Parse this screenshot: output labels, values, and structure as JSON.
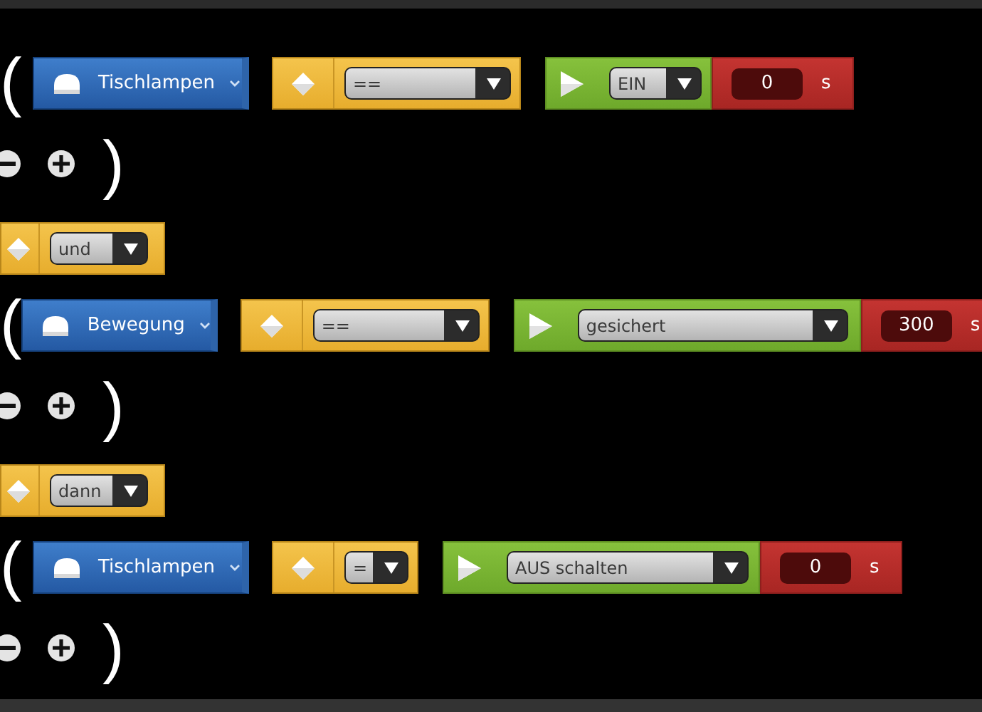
{
  "rows": [
    {
      "kind": "group",
      "open": "(",
      "device": "Tischlampen",
      "operator": "==",
      "value": "EIN",
      "delay": "0",
      "unit": "s",
      "close": ")"
    },
    {
      "kind": "connector",
      "value": "und"
    },
    {
      "kind": "group",
      "open": "(",
      "device": "Bewegung",
      "operator": "==",
      "value": "gesichert",
      "delay": "300",
      "unit": "s",
      "close": ")"
    },
    {
      "kind": "connector",
      "value": "dann"
    },
    {
      "kind": "group",
      "open": "(",
      "device": "Tischlampen",
      "operator": "=",
      "value": "AUS schalten",
      "delay": "0",
      "unit": "s",
      "close": ")"
    }
  ]
}
